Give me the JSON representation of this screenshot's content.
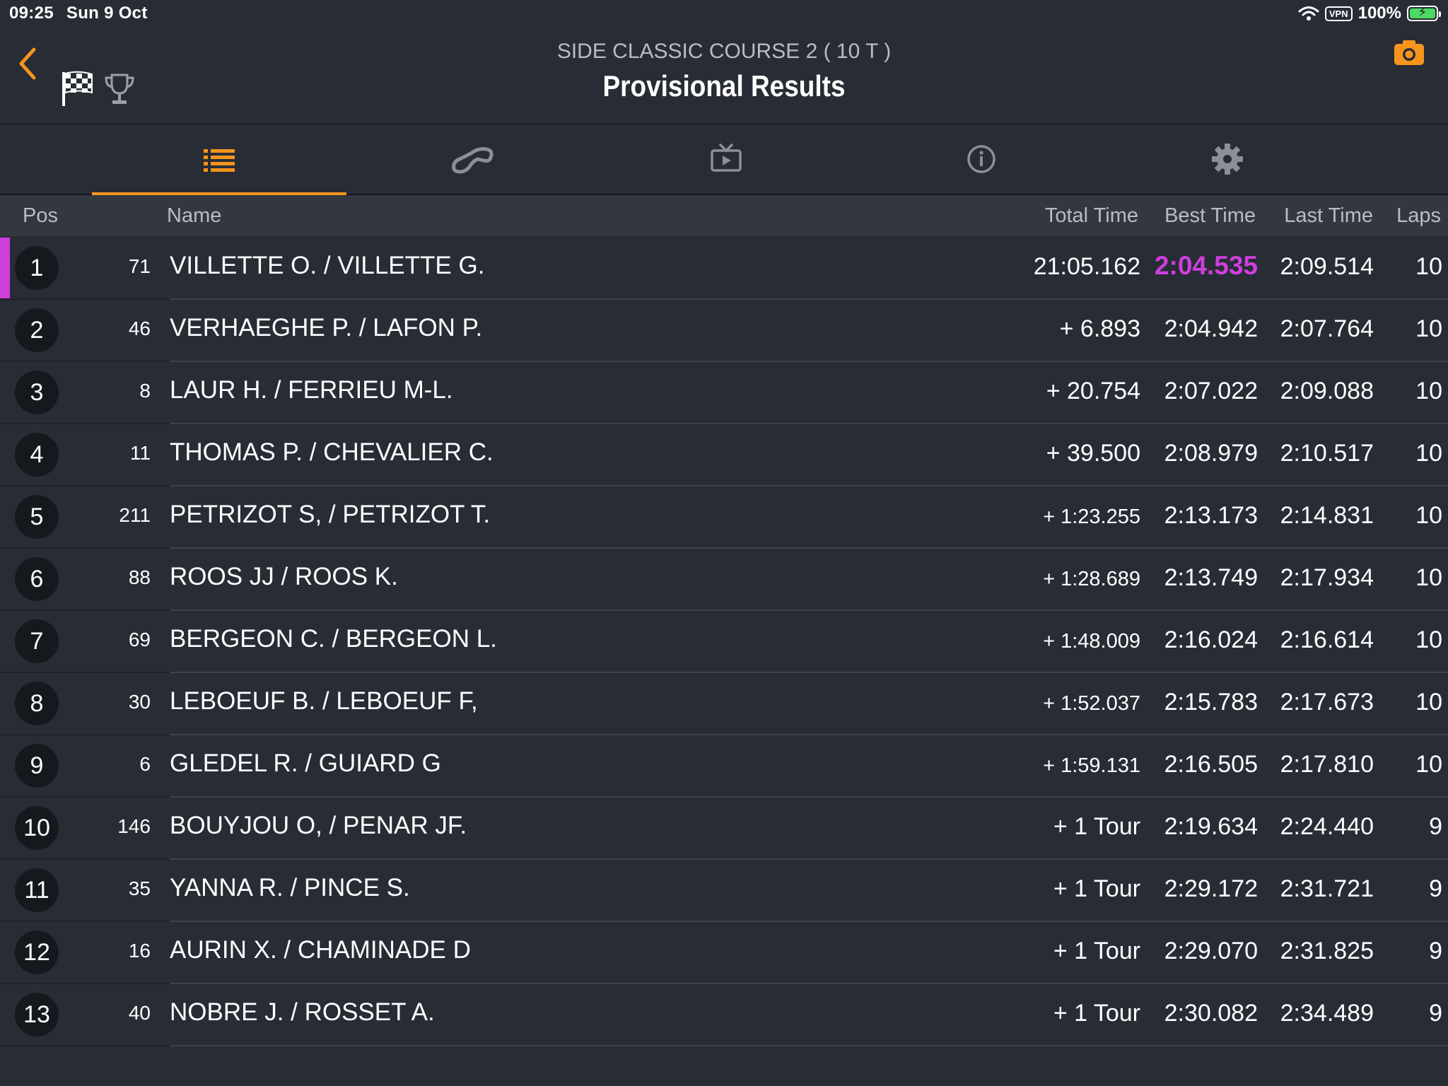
{
  "status_bar": {
    "time": "09:25",
    "date": "Sun 9 Oct",
    "vpn": "VPN",
    "battery": "100%"
  },
  "header": {
    "subtitle": "SIDE CLASSIC COURSE 2 ( 10 T )",
    "title": "Provisional Results"
  },
  "colors": {
    "accent": "#f7941d",
    "fastest": "#cf3fdc",
    "background": "#282c35"
  },
  "tabs": [
    {
      "icon": "list-icon",
      "active": true
    },
    {
      "icon": "track-map-icon",
      "active": false
    },
    {
      "icon": "tv-play-icon",
      "active": false
    },
    {
      "icon": "info-icon",
      "active": false
    },
    {
      "icon": "gear-icon",
      "active": false
    }
  ],
  "columns": {
    "pos": "Pos",
    "name": "Name",
    "total": "Total Time",
    "best": "Best Time",
    "last": "Last Time",
    "laps": "Laps"
  },
  "results": [
    {
      "pos": "1",
      "num": "71",
      "name": "VILLETTE O. / VILLETTE G.",
      "total": "21:05.162",
      "best": "2:04.535",
      "last": "2:09.514",
      "laps": "10"
    },
    {
      "pos": "2",
      "num": "46",
      "name": "VERHAEGHE P. / LAFON P.",
      "total": "+ 6.893",
      "best": "2:04.942",
      "last": "2:07.764",
      "laps": "10"
    },
    {
      "pos": "3",
      "num": "8",
      "name": "LAUR H. / FERRIEU M-L.",
      "total": "+ 20.754",
      "best": "2:07.022",
      "last": "2:09.088",
      "laps": "10"
    },
    {
      "pos": "4",
      "num": "11",
      "name": "THOMAS P. / CHEVALIER C.",
      "total": "+ 39.500",
      "best": "2:08.979",
      "last": "2:10.517",
      "laps": "10"
    },
    {
      "pos": "5",
      "num": "211",
      "name": "PETRIZOT S, / PETRIZOT T.",
      "total": "+ 1:23.255",
      "best": "2:13.173",
      "last": "2:14.831",
      "laps": "10"
    },
    {
      "pos": "6",
      "num": "88",
      "name": "ROOS JJ / ROOS K.",
      "total": "+ 1:28.689",
      "best": "2:13.749",
      "last": "2:17.934",
      "laps": "10"
    },
    {
      "pos": "7",
      "num": "69",
      "name": "BERGEON C. / BERGEON L.",
      "total": "+ 1:48.009",
      "best": "2:16.024",
      "last": "2:16.614",
      "laps": "10"
    },
    {
      "pos": "8",
      "num": "30",
      "name": "LEBOEUF B. /  LEBOEUF F,",
      "total": "+ 1:52.037",
      "best": "2:15.783",
      "last": "2:17.673",
      "laps": "10"
    },
    {
      "pos": "9",
      "num": "6",
      "name": "GLEDEL R. / GUIARD G",
      "total": "+ 1:59.131",
      "best": "2:16.505",
      "last": "2:17.810",
      "laps": "10"
    },
    {
      "pos": "10",
      "num": "146",
      "name": "BOUYJOU O, / PENAR JF.",
      "total": "+ 1 Tour",
      "best": "2:19.634",
      "last": "2:24.440",
      "laps": "9"
    },
    {
      "pos": "11",
      "num": "35",
      "name": "YANNA R. / PINCE S.",
      "total": "+ 1 Tour",
      "best": "2:29.172",
      "last": "2:31.721",
      "laps": "9"
    },
    {
      "pos": "12",
      "num": "16",
      "name": "AURIN X. / CHAMINADE D",
      "total": "+ 1 Tour",
      "best": "2:29.070",
      "last": "2:31.825",
      "laps": "9"
    },
    {
      "pos": "13",
      "num": "40",
      "name": "NOBRE J. / ROSSET A.",
      "total": "+ 1 Tour",
      "best": "2:30.082",
      "last": "2:34.489",
      "laps": "9"
    }
  ]
}
